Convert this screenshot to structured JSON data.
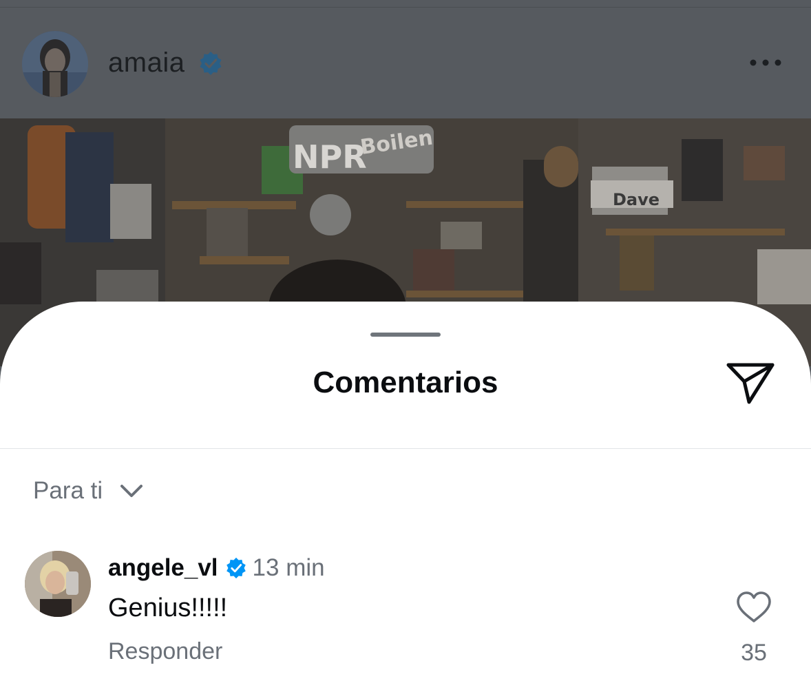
{
  "post": {
    "username": "amaia",
    "verified": true,
    "more_icon": "more-horizontal-icon",
    "photo_signs": {
      "npr": "NPR",
      "boiler": "Boilen",
      "dave": "Dave"
    }
  },
  "sheet": {
    "title": "Comentarios",
    "share_icon": "paper-plane-icon",
    "filter": {
      "label": "Para ti",
      "icon": "chevron-down-icon"
    }
  },
  "comments": [
    {
      "username": "angele_vl",
      "verified": true,
      "time": "13 min",
      "text": "Genius!!!!!",
      "reply_label": "Responder",
      "like_icon": "heart-icon",
      "likes": "35"
    }
  ],
  "colors": {
    "overlay_bg": "#555a5f",
    "sheet_bg": "#ffffff",
    "verified_blue": "#0095f6",
    "verified_dim": "#2a5f86",
    "text_primary": "#0b0d10",
    "text_secondary": "#6a7078"
  }
}
